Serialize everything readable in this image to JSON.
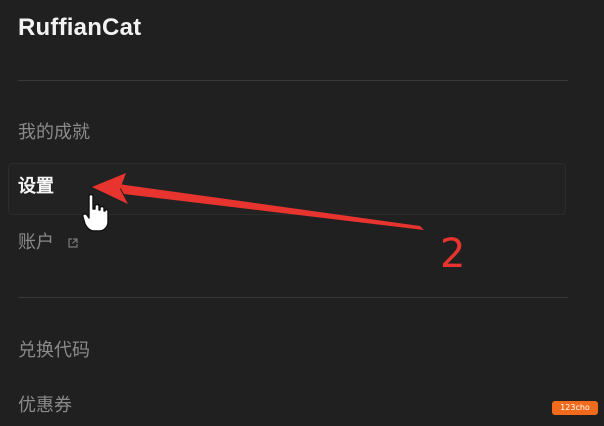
{
  "profile": {
    "username": "RuffianCat"
  },
  "menu": {
    "achievements": "我的成就",
    "settings": "设置",
    "account": "账户",
    "redeem_code": "兑换代码",
    "coupons": "优惠券"
  },
  "icons": {
    "external_link": "external-link-icon",
    "pointer_cursor": "hand-cursor-icon"
  },
  "annotation": {
    "step_number": "2",
    "color": "#e8342e"
  },
  "watermark": {
    "text": "123cho"
  }
}
